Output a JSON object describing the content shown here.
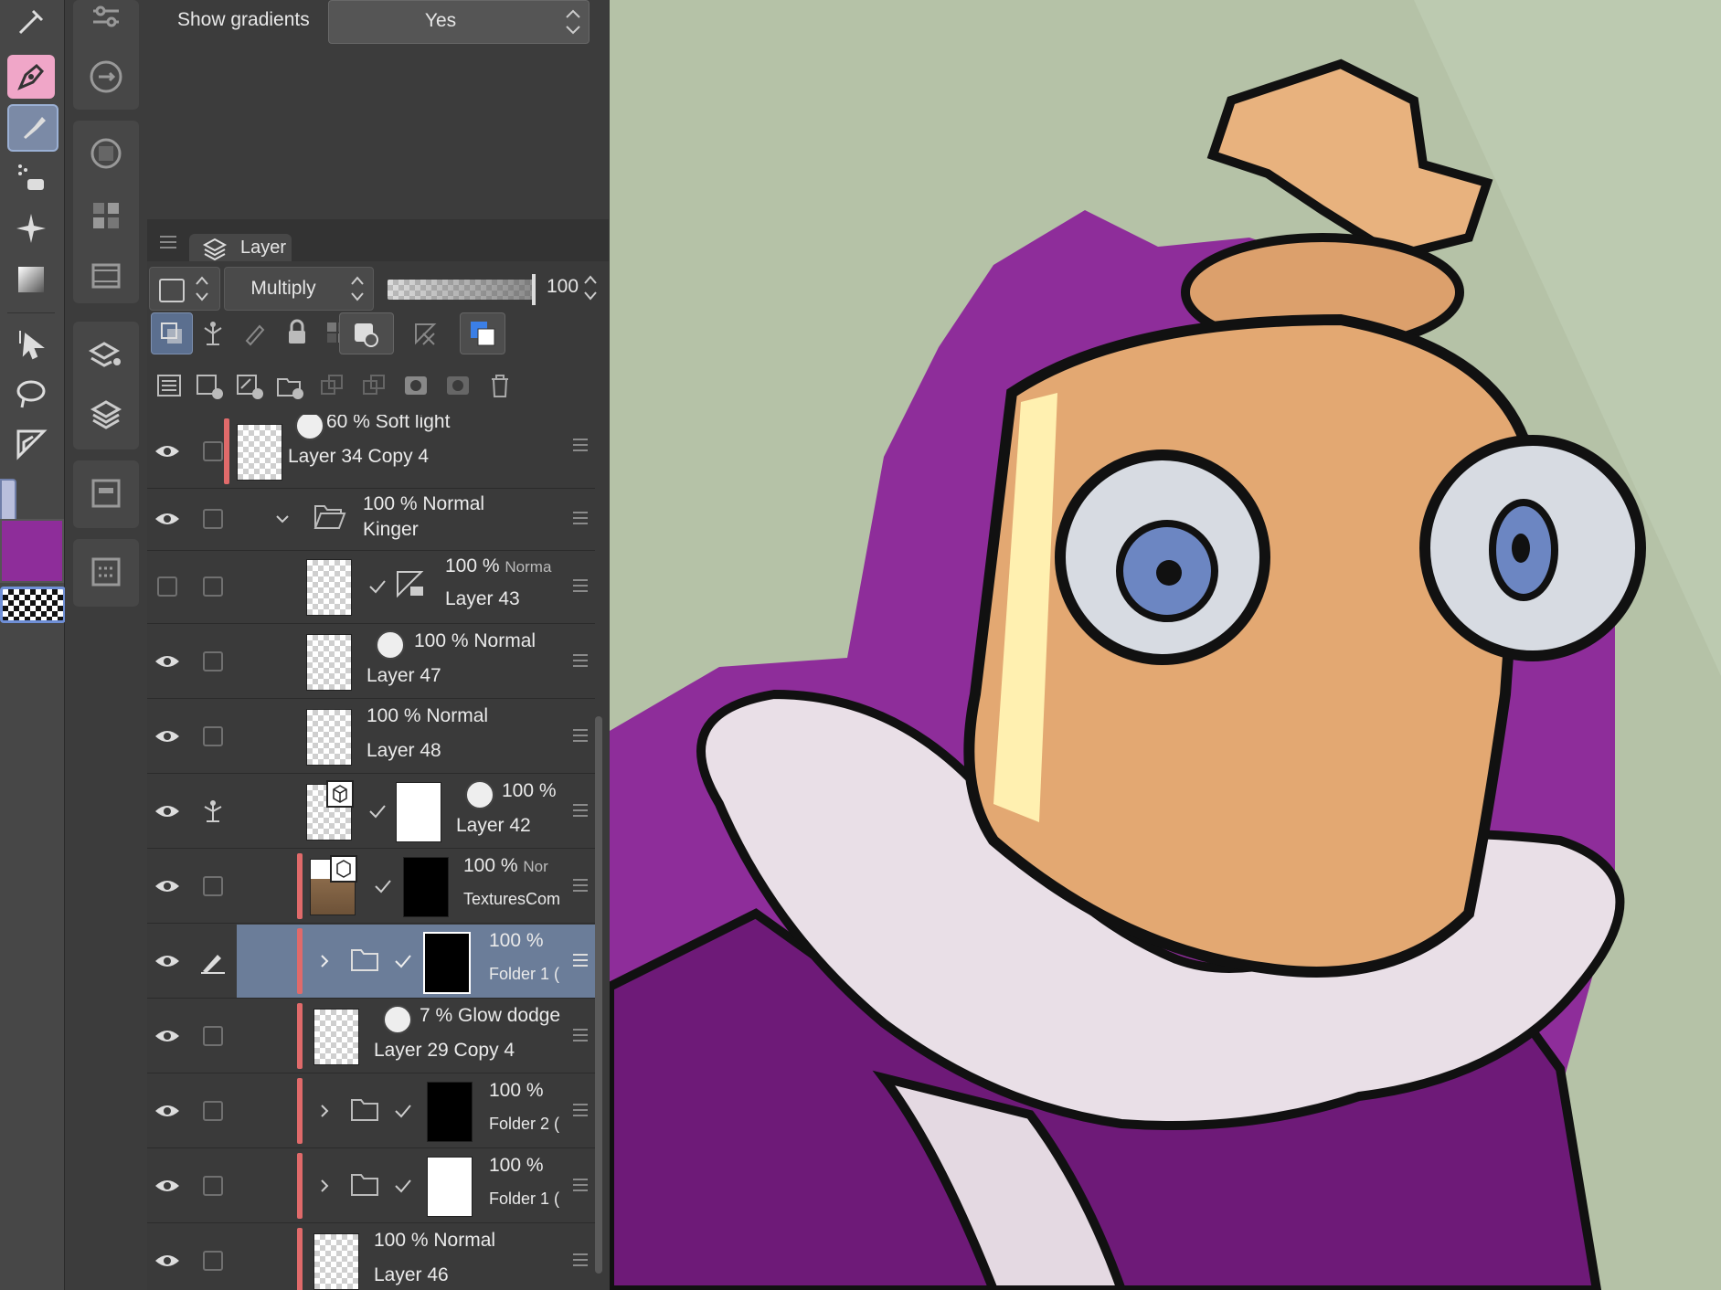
{
  "colors": {
    "canvas_bg": "#b5c2a7",
    "primary_color": "#8e2d9a",
    "selected_row": "#6b7d99",
    "clip_marker": "#e06a6a"
  },
  "tool_property": {
    "label": "Show gradients",
    "value": "Yes"
  },
  "layer_panel": {
    "tab_label": "Layer",
    "blend_mode": "Multiply",
    "opacity": "100",
    "opacity_fraction": 1.0
  },
  "layers": [
    {
      "pct": "60 %",
      "mode": "Soft light",
      "name": "Layer 34 Copy 4",
      "eye": true
    },
    {
      "pct": "100 %",
      "mode": "Normal",
      "name": "Kinger",
      "eye": true,
      "folder": true
    },
    {
      "pct": "100 %",
      "mode": "Norma",
      "name": "Layer 43",
      "eye": false
    },
    {
      "pct": "100 %",
      "mode": "Normal",
      "name": "Layer 47",
      "eye": true
    },
    {
      "pct": "100 %",
      "mode": "Normal",
      "name": "Layer 48",
      "eye": true
    },
    {
      "pct": "100 %",
      "mode": "",
      "name": "Layer 42",
      "eye": true
    },
    {
      "pct": "100 %",
      "mode": "Nor",
      "name": "TexturesCom",
      "eye": true
    },
    {
      "pct": "100 %",
      "mode": "",
      "name": "Folder 1 (",
      "eye": true,
      "selected": true
    },
    {
      "pct": "7 %",
      "mode": "Glow dodge",
      "name": "Layer 29 Copy 4",
      "eye": true
    },
    {
      "pct": "100 %",
      "mode": "",
      "name": "Folder 2 (",
      "eye": true
    },
    {
      "pct": "100 %",
      "mode": "",
      "name": "Folder 1 (",
      "eye": true
    },
    {
      "pct": "100 %",
      "mode": "Normal",
      "name": "Layer 46",
      "eye": true
    }
  ]
}
